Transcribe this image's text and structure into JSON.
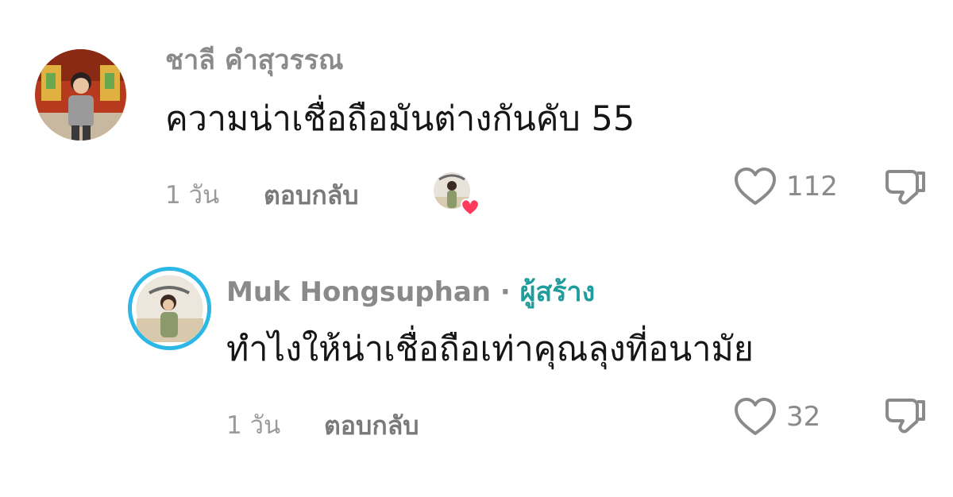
{
  "comments": [
    {
      "username": "ชาลี คำสุวรรณ",
      "text": "ความน่าเชื่อถือมันต่างกันคับ 55",
      "time": "1 วัน",
      "reply_label": "ตอบกลับ",
      "like_count": "112",
      "liked_by_creator": true
    },
    {
      "username": "Muk Hongsuphan",
      "separator": "·",
      "creator_label": "ผู้สร้าง",
      "text": "ทำไงให้น่าเชื่อถือเท่าคุณลุงที่อนามัย",
      "time": "1 วัน",
      "reply_label": "ตอบกลับ",
      "like_count": "32"
    }
  ],
  "colors": {
    "creator_accent": "#1f9c9c",
    "heart_red": "#ff3b5c",
    "avatar_ring": "#2bb8e6"
  }
}
